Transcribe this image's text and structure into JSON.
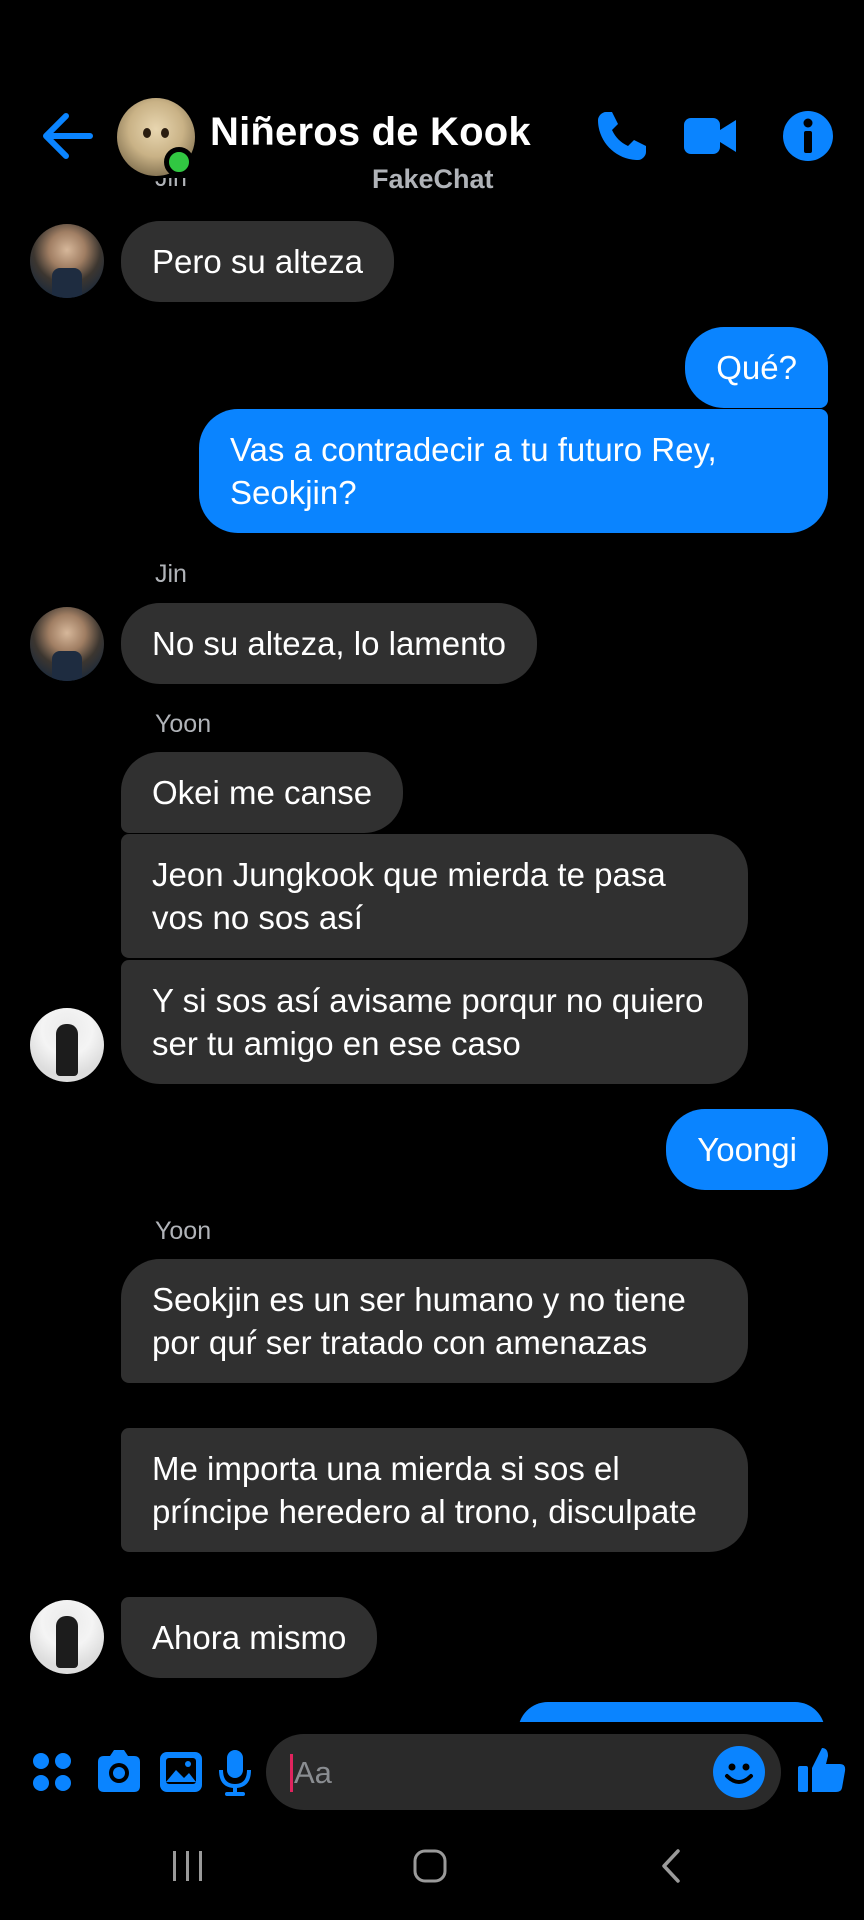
{
  "header": {
    "title": "Niñeros de Kook",
    "subtitle": "FakeChat"
  },
  "messages": [
    {
      "side": "in",
      "sender": "",
      "text": "Pero su alteza"
    },
    {
      "side": "out",
      "text": "Qué?"
    },
    {
      "side": "out",
      "text": "Vas a contradecir a tu futuro Rey, Seokjin?"
    },
    {
      "side": "in",
      "sender": "Jin",
      "text": "No su alteza, lo lamento"
    },
    {
      "side": "in",
      "sender": "Yoon",
      "text": "Okei me canse"
    },
    {
      "side": "in",
      "sender": "",
      "text": "Jeon Jungkook que mierda te pasa vos no sos así"
    },
    {
      "side": "in",
      "sender": "",
      "text": "Y si sos así avisame porqur no quiero ser tu amigo en ese caso"
    },
    {
      "side": "out",
      "text": "Yoongi"
    },
    {
      "side": "in",
      "sender": "Yoon",
      "text": "Seokjin es un ser humano y no tiene por quŕ ser tratado con amenazas"
    },
    {
      "side": "in",
      "sender": "",
      "text": "Me importa una mierda si sos el príncipe heredero al trono, disculpate"
    },
    {
      "side": "in",
      "sender": "",
      "text": "Ahora mismo"
    }
  ],
  "composer": {
    "placeholder": "Aa"
  },
  "colors": {
    "accent": "#0a84ff",
    "incoming_bubble": "#303030",
    "online": "#31c742",
    "background": "#000000"
  },
  "icons": [
    "back-arrow-icon",
    "phone-icon",
    "video-camera-icon",
    "info-icon",
    "apps-grid-icon",
    "camera-icon",
    "gallery-icon",
    "microphone-icon",
    "emoji-icon",
    "thumbs-up-icon",
    "recent-apps-icon",
    "home-icon",
    "back-nav-icon"
  ]
}
